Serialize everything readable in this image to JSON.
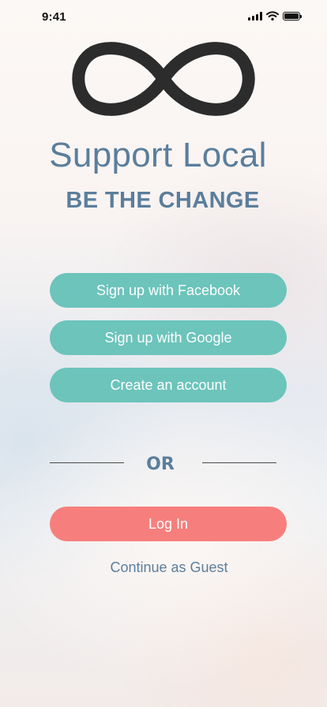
{
  "status_bar": {
    "time": "9:41"
  },
  "app": {
    "title": "Support Local",
    "tagline": "BE THE CHANGE",
    "logo_icon": "infinity-icon"
  },
  "signup": {
    "facebook_label": "Sign up with Facebook",
    "google_label": "Sign up with Google",
    "create_account_label": "Create an account"
  },
  "divider": {
    "text": "OR"
  },
  "login": {
    "login_label": "Log In",
    "guest_label": "Continue as Guest"
  },
  "colors": {
    "title": "#5b7e9c",
    "teal_button": "#6cc4bb",
    "coral_button": "#f67f7d",
    "logo": "#2c2c2c"
  }
}
